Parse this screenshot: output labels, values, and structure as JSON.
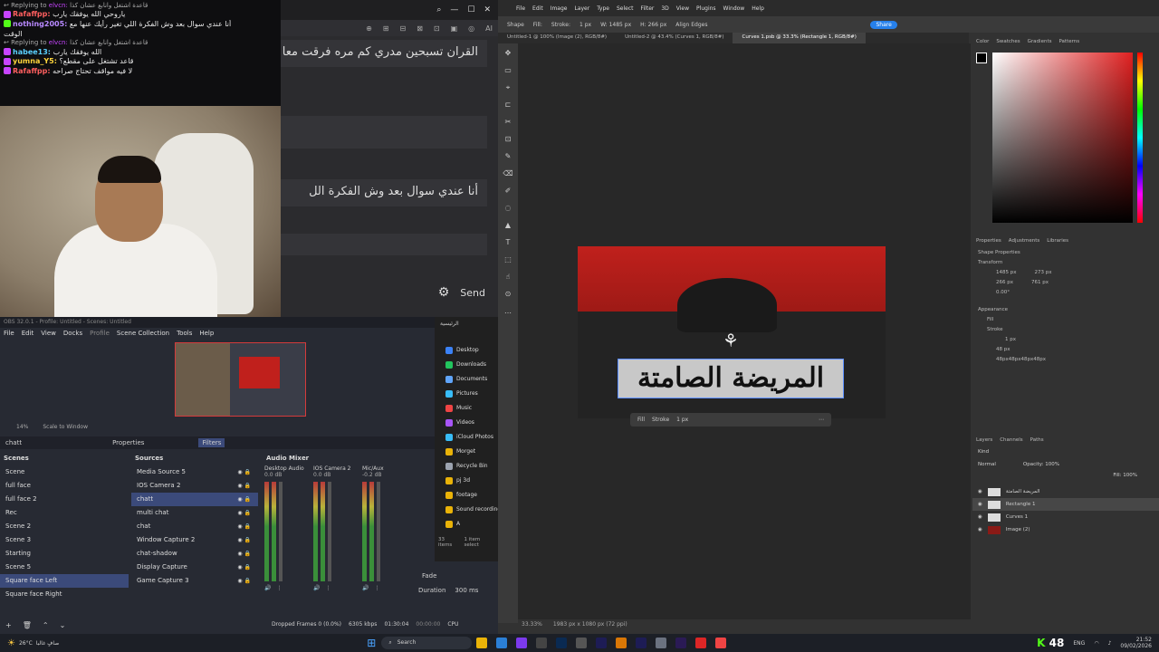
{
  "chat": {
    "lines": [
      {
        "reply": "Replying to",
        "reply_user": "elvcn:",
        "reply_text": "قاعدة اشتغل وانابع عشان كذا"
      },
      {
        "user": "Rafaffpp:",
        "text": "ياروحي الله يوفقك يارب",
        "color": "#ff5f5f"
      },
      {
        "user": "nothing2005:",
        "text": "أنا عندي سوال بعد وش الفكرة اللي تغير رأيك عنها مع",
        "color": "#b889ff"
      },
      {
        "user": "",
        "text": "الوقت",
        "color": "#b889ff"
      },
      {
        "reply": "Replying to",
        "reply_user": "elvcn:",
        "reply_text": "قاعدة اشتغل وانابع عشان كذا"
      },
      {
        "user": "habee13:",
        "text": "الله يوفقك يارب",
        "color": "#5ad0ff"
      },
      {
        "user": "yumna_Y5:",
        "text": "قاعد تشتغل على مقطع؟",
        "color": "#ffd43b"
      },
      {
        "user": "Rafaffpp:",
        "text": "لا فيه مواقف تحتاج صراحه",
        "color": "#ff5f5f"
      }
    ]
  },
  "assistant": {
    "messages": [
      "القران تسبحين مدري كم مره فرقت معا",
      "أنا عندي سوال بعد وش الفكرة الل"
    ],
    "send_label": "Send",
    "tool_icons": [
      "⊕",
      "⊞",
      "⊟",
      "⊠",
      "⊡",
      "▣",
      "◎",
      "AI"
    ]
  },
  "obs": {
    "title": "OBS 32.0.1 - Profile: Untitled - Scenes: Untitled",
    "menu": [
      "File",
      "Edit",
      "View",
      "Docks",
      "Profile",
      "Scene Collection",
      "Tools",
      "Help"
    ],
    "zoom": "14%",
    "scale_label": "Scale to Window",
    "source_name": "chatt",
    "properties_label": "Properties",
    "filters_label": "Filters",
    "scenes_title": "Scenes",
    "scenes": [
      "Scene",
      "full face",
      "full face 2",
      "Rec",
      "Scene 2",
      "Scene 3",
      "Starting",
      "Scene 5",
      "Square face Left",
      "Square face Right"
    ],
    "selected_scene": "Square face Left",
    "sources_title": "Sources",
    "sources": [
      "Media Source 5",
      "IOS Camera 2",
      "chatt",
      "multi chat",
      "chat",
      "Window Capture 2",
      "chat-shadow",
      "Display Capture",
      "Game Capture 3"
    ],
    "mixer_title": "Audio Mixer",
    "channels": [
      {
        "name": "Desktop Audio",
        "db": "0.0 dB"
      },
      {
        "name": "IOS Camera 2",
        "db": "0.0 dB"
      },
      {
        "name": "Mic/Aux",
        "db": "-0.2 dB"
      }
    ],
    "scale_marks": [
      "0",
      "-5",
      "-10",
      "-15",
      "-20",
      "-25",
      "-30",
      "-35",
      "-40",
      "-45",
      "-50",
      "-55",
      "-60"
    ],
    "transition_label": "Fade",
    "duration_label": "Duration",
    "duration": "300 ms",
    "status": {
      "dropped": "Dropped Frames 0 (0.0%)",
      "kbps": "6305 kbps",
      "rec": "01:30:04",
      "stream": "00:00:00",
      "cpu": "CPU"
    }
  },
  "explorer": {
    "path": "الرئيسية‬",
    "items": [
      "Desktop",
      "Downloads",
      "Documents",
      "Pictures",
      "Music",
      "Videos",
      "iCloud Photos",
      "Morget",
      "Recycle Bin",
      "pj 3d",
      "footage",
      "Sound recording",
      "A"
    ],
    "colors": [
      "#3b82f6",
      "#22c55e",
      "#60a5fa",
      "#38bdf8",
      "#ef4444",
      "#a855f7",
      "#38bdf8",
      "#eab308",
      "#9ca3af",
      "#eab308",
      "#eab308",
      "#eab308",
      "#eab308"
    ],
    "count": "33 items",
    "selected": "1 item select"
  },
  "ps": {
    "menu": [
      "File",
      "Edit",
      "Image",
      "Layer",
      "Type",
      "Select",
      "Filter",
      "3D",
      "View",
      "Plugins",
      "Window",
      "Help"
    ],
    "options": [
      "Shape",
      "Fill:",
      "Stroke:",
      "1 px",
      "W: 1485 px",
      "H: 266 px",
      "Align Edges"
    ],
    "share": "Share",
    "tabs": [
      "Untitled-1 @ 100% (Image (2), RGB/8#)",
      "Untitled-2 @ 43.4% (Curves 1, RGB/8#)",
      "Curves 1.psb @ 33.3% (Rectangle 1, RGB/8#)"
    ],
    "art_text": "المريضة الصامتة",
    "ctx": [
      "Fill",
      "Stroke",
      "1 px"
    ],
    "color_tabs": [
      "Color",
      "Swatches",
      "Gradients",
      "Patterns"
    ],
    "prop_tabs": [
      "Properties",
      "Adjustments",
      "Libraries"
    ],
    "shape_props": "Shape Properties",
    "transform": "Transform",
    "w": "1485 px",
    "h": "266 px",
    "x": "273 px",
    "y": "761 px",
    "angle": "0.00°",
    "appearance": "Appearance",
    "fill": "Fill",
    "stroke": "Stroke",
    "px": "1 px",
    "radius": "48 px",
    "radius_label": "48px48px48px48px",
    "layer_tabs": [
      "Layers",
      "Channels",
      "Paths"
    ],
    "kind": "Kind",
    "mode": "Normal",
    "opacity": "Opacity: 100%",
    "fill_pct": "Fill: 100%",
    "layers": [
      "المريضة الصامتة",
      "Rectangle 1",
      "Curves 1",
      "Image (2)"
    ],
    "zoom": "33.33%",
    "doc_size": "1983 px x 1080 px (72 ppi)"
  },
  "taskbar": {
    "weather": "26°C",
    "weather_desc": "صافٍ غالبا",
    "search": "Search",
    "lang": "ENG",
    "time": "21:52",
    "date": "09/02/2026",
    "kick_count": "48"
  }
}
